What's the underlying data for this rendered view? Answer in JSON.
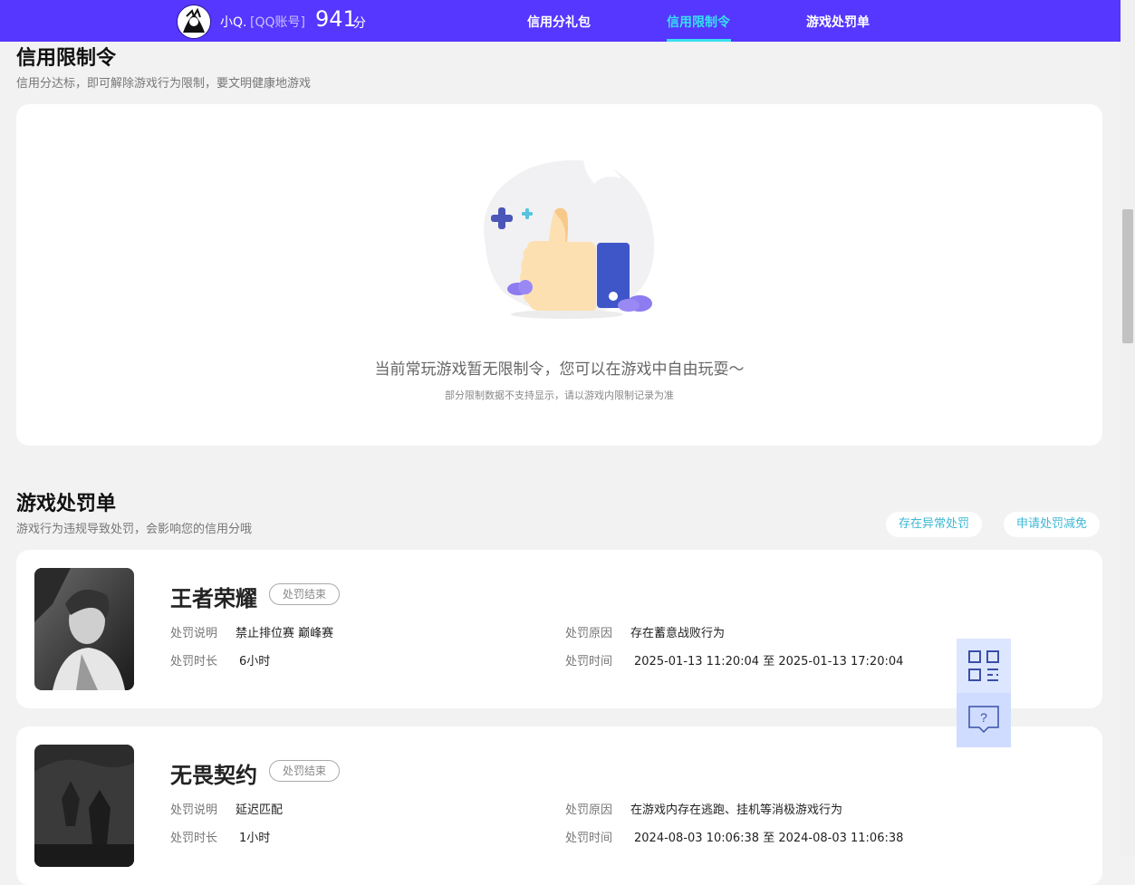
{
  "header": {
    "user_name": "小Q.",
    "account_type": "[QQ账号]",
    "score": "941",
    "score_unit": "分",
    "tabs": [
      {
        "label": "信用分礼包",
        "active": false
      },
      {
        "label": "信用限制令",
        "active": true
      },
      {
        "label": "游戏处罚单",
        "active": false
      }
    ],
    "accent_color": "#5537ff",
    "active_tab_color": "#37e0f0"
  },
  "restriction": {
    "title": "信用限制令",
    "subtitle": "信用分达标，即可解除游戏行为限制，要文明健康地游戏",
    "empty_message": "当前常玩游戏暂无限制令，您可以在游戏中自由玩耍～",
    "empty_note": "部分限制数据不支持显示，请以游戏内限制记录为准",
    "illustration_icon": "thumbs-up-icon"
  },
  "penalties": {
    "title": "游戏处罚单",
    "subtitle": "游戏行为违规导致处罚，会影响您的信用分哦",
    "actions": [
      "存在异常处罚",
      "申请处罚减免"
    ],
    "labels": {
      "description": "处罚说明",
      "duration": "处罚时长",
      "reason": "处罚原因",
      "time": "处罚时间"
    },
    "items": [
      {
        "game": "王者荣耀",
        "status": "处罚结束",
        "description": "禁止排位赛 巅峰赛",
        "duration": "6小时",
        "reason": "存在蓄意战败行为",
        "time": "2025-01-13 11:20:04 至 2025-01-13 17:20:04"
      },
      {
        "game": "无畏契约",
        "status": "处罚结束",
        "description": "延迟匹配",
        "duration": "1小时",
        "reason": "在游戏内存在逃跑、挂机等消极游戏行为",
        "time": "2024-08-03 10:06:38 至 2024-08-03 11:06:38"
      }
    ]
  },
  "floating": {
    "icons": [
      "qr-code-icon",
      "help-chat-icon"
    ]
  }
}
